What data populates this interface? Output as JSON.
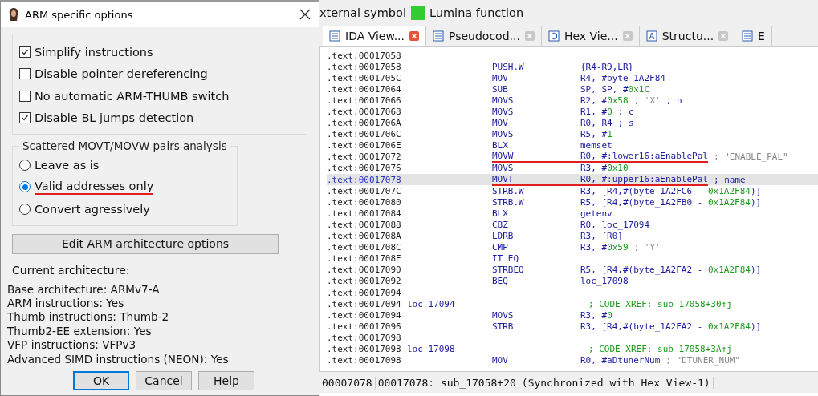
{
  "dialog": {
    "title": "ARM specific options",
    "options": [
      {
        "label": "Simplify instructions",
        "checked": true
      },
      {
        "label": "Disable pointer dereferencing",
        "checked": false
      },
      {
        "label": "No automatic ARM-THUMB switch",
        "checked": false
      },
      {
        "label": "Disable BL jumps detection",
        "checked": true
      }
    ],
    "movt_group": {
      "legend": "Scattered MOVT/MOVW pairs analysis",
      "choices": [
        {
          "label": "Leave as is",
          "selected": false,
          "underlined": false
        },
        {
          "label": "Valid addresses only",
          "selected": true,
          "underlined": true
        },
        {
          "label": "Convert agressively",
          "selected": false,
          "underlined": false
        }
      ]
    },
    "edit_button": "Edit ARM architecture options",
    "current_heading": "Current architecture:",
    "info": [
      "Base architecture: ARMv7-A",
      "ARM instructions: Yes",
      "Thumb instructions: Thumb-2",
      "Thumb2-EE extension: Yes",
      "VFP instructions: VFPv3",
      "Advanced SIMD instructions (NEON): Yes"
    ],
    "buttons": [
      {
        "label": "OK",
        "default": true
      },
      {
        "label": "Cancel",
        "default": false
      },
      {
        "label": "Help",
        "default": false
      }
    ]
  },
  "ida": {
    "legend": [
      {
        "label": "xternal symbol"
      },
      {
        "label": "Lumina function",
        "color": "#33cc33"
      }
    ],
    "tabs": [
      {
        "label": "IDA View...",
        "selected": true,
        "kind": "text"
      },
      {
        "label": "Pseudocod...",
        "selected": false,
        "kind": "text"
      },
      {
        "label": "Hex Vie...",
        "selected": false,
        "kind": "hex"
      },
      {
        "label": "Structu...",
        "selected": false,
        "kind": "struct"
      },
      {
        "label": "E",
        "selected": false,
        "kind": "list"
      }
    ],
    "lines": [
      {
        "address": ".text:00017058",
        "selected": false,
        "underlined": false
      },
      {
        "address": ".text:00017058",
        "mnemonic": "PUSH.W",
        "operands": "{R4-R9,LR}",
        "selected": false,
        "underlined": false
      },
      {
        "address": ".text:0001705C",
        "mnemonic": "MOV",
        "operands": "R4, #byte_1A2F84",
        "selected": false,
        "underlined": false
      },
      {
        "address": ".text:00017064",
        "mnemonic": "SUB",
        "operands": "SP, SP, #0x1C",
        "selected": false,
        "underlined": false
      },
      {
        "address": ".text:00017066",
        "mnemonic": "MOVS",
        "operands": "R2, #0x58",
        "comment": [
          {
            "text": "; 'X'",
            "kind": "string"
          },
          {
            "text": "; n",
            "kind": "name"
          }
        ],
        "selected": false,
        "underlined": false
      },
      {
        "address": ".text:00017068",
        "mnemonic": "MOVS",
        "operands": "R1, #0",
        "comment": [
          {
            "text": "; c",
            "kind": "name"
          }
        ],
        "selected": false,
        "underlined": false
      },
      {
        "address": ".text:0001706A",
        "mnemonic": "MOV",
        "operands": "R0, R4",
        "comment": [
          {
            "text": "; s",
            "kind": "name"
          }
        ],
        "selected": false,
        "underlined": false
      },
      {
        "address": ".text:0001706C",
        "mnemonic": "MOVS",
        "operands": "R5, #1",
        "selected": false,
        "underlined": false
      },
      {
        "address": ".text:0001706E",
        "mnemonic": "BLX",
        "operands": "memset",
        "selected": false,
        "underlined": false
      },
      {
        "address": ".text:00017072",
        "mnemonic": "MOVW",
        "operands": "R0, #:lower16:aEnablePal",
        "comment": [
          {
            "text": "; \"ENABLE_PAL\"",
            "kind": "string"
          }
        ],
        "selected": false,
        "underlined": true
      },
      {
        "address": ".text:00017076",
        "mnemonic": "MOVS",
        "operands": "R3, #0x10",
        "selected": false,
        "underlined": false
      },
      {
        "address": ".text:00017078",
        "mnemonic": "MOVT",
        "operands": "R0, #:upper16:aEnablePal",
        "comment": [
          {
            "text": "; name",
            "kind": "name"
          }
        ],
        "selected": true,
        "underlined": true
      },
      {
        "address": ".text:0001707C",
        "mnemonic": "STRB.W",
        "operands": "R3, [R4,#(byte_1A2FC6 - 0x1A2F84)]",
        "selected": false,
        "underlined": false
      },
      {
        "address": ".text:00017080",
        "mnemonic": "STRB.W",
        "operands": "R5, [R4,#(byte_1A2FB0 - 0x1A2F84)]",
        "selected": false,
        "underlined": false
      },
      {
        "address": ".text:00017084",
        "mnemonic": "BLX",
        "operands": "getenv",
        "selected": false,
        "underlined": false
      },
      {
        "address": ".text:00017088",
        "mnemonic": "CBZ",
        "operands": "R0, loc_17094",
        "selected": false,
        "underlined": false
      },
      {
        "address": ".text:0001708A",
        "mnemonic": "LDRB",
        "operands": "R3, [R0]",
        "selected": false,
        "underlined": false
      },
      {
        "address": ".text:0001708C",
        "mnemonic": "CMP",
        "operands": "R3, #0x59",
        "comment": [
          {
            "text": "; 'Y'",
            "kind": "string"
          }
        ],
        "selected": false,
        "underlined": false
      },
      {
        "address": ".text:0001708E",
        "mnemonic": "IT EQ",
        "selected": false,
        "underlined": false
      },
      {
        "address": ".text:00017090",
        "mnemonic": "STRBEQ",
        "operands": "R5, [R4,#(byte_1A2FA2 - 0x1A2F84)]",
        "selected": false,
        "underlined": false
      },
      {
        "address": ".text:00017092",
        "mnemonic": "BEQ",
        "operands": "loc_17098",
        "selected": false,
        "underlined": false
      },
      {
        "address": ".text:00017094",
        "selected": false,
        "underlined": false
      },
      {
        "address": ".text:00017094",
        "label": "loc_17094",
        "xref": "; CODE XREF: sub_17058+30↑j",
        "selected": false,
        "underlined": false
      },
      {
        "address": ".text:00017094",
        "mnemonic": "MOVS",
        "operands": "R3, #0",
        "selected": false,
        "underlined": false
      },
      {
        "address": ".text:00017096",
        "mnemonic": "STRB",
        "operands": "R3, [R4,#(byte_1A2FA2 - 0x1A2F84)]",
        "selected": false,
        "underlined": false
      },
      {
        "address": ".text:00017098",
        "selected": false,
        "underlined": false
      },
      {
        "address": ".text:00017098",
        "label": "loc_17098",
        "xref": "; CODE XREF: sub_17058+3A↑j",
        "selected": false,
        "underlined": false
      },
      {
        "address": ".text:00017098",
        "mnemonic": "MOV",
        "operands": "R0, #aDtunerNum",
        "comment": [
          {
            "text": "; \"DTUNER_NUM\"",
            "kind": "string"
          }
        ],
        "selected": false,
        "underlined": false
      }
    ],
    "status": [
      "00007078",
      "00017078: sub_17058+20",
      "(Synchronized with Hex View-1)"
    ]
  }
}
